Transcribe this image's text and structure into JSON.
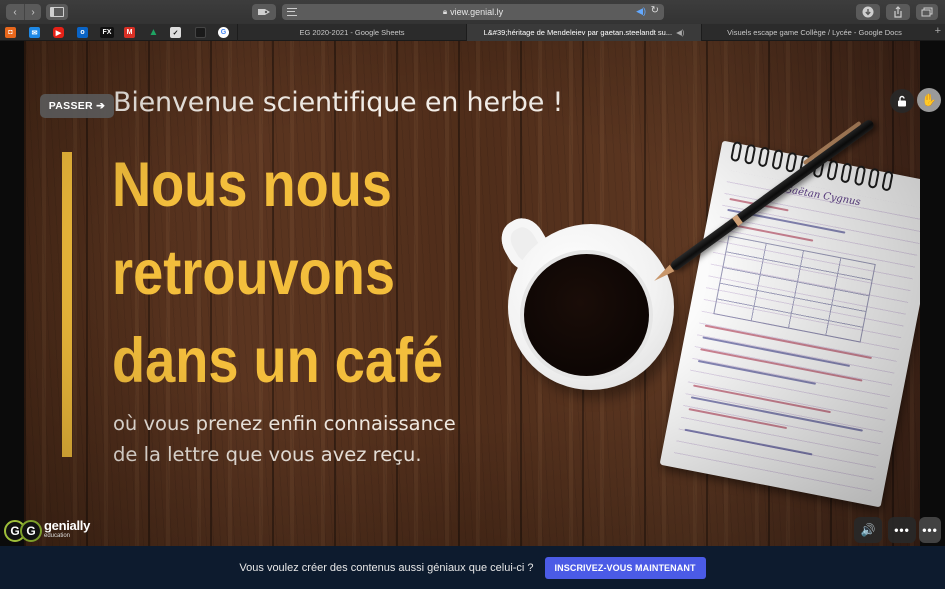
{
  "browser": {
    "url": "view.genial.ly",
    "tabs": [
      {
        "label": "EG 2020-2021 - Google Sheets"
      },
      {
        "label": "L&#39;héritage de Mendeleiev par gaetan.steelandt su..."
      },
      {
        "label": "Visuels escape game Collège / Lycée - Google Docs"
      }
    ],
    "bookmarks": [
      {
        "icon": "bookmark-orange-icon",
        "color": "#e8671c"
      },
      {
        "icon": "bookmark-blue-icon",
        "color": "#1e88e5"
      },
      {
        "icon": "youtube-icon",
        "color": "#e62117"
      },
      {
        "icon": "outlook-icon",
        "color": "#0a64c6"
      },
      {
        "icon": "fx-icon",
        "color": "#111111"
      },
      {
        "icon": "gmail-icon",
        "color": "#d93025"
      },
      {
        "icon": "google-drive-icon",
        "color": "#1fa463"
      },
      {
        "icon": "nike-icon",
        "color": "#dddddd"
      },
      {
        "icon": "dark-square-icon",
        "color": "#1a1a1a"
      },
      {
        "icon": "google-icon",
        "color": "#ffffff"
      }
    ]
  },
  "slide": {
    "skip_label": "PASSER ➔",
    "greeting": "Bienvenue scientifique en herbe !",
    "headline": [
      "Nous nous",
      "retrouvons",
      "dans un café"
    ],
    "subtitle": [
      "où vous prenez enfin connaissance",
      "de la lettre que vous avez reçu."
    ],
    "notebook_title": "Gaëtan Cygnus",
    "accent_color": "#f3be3c"
  },
  "brand": {
    "name": "genially",
    "sub": "education"
  },
  "controls": {
    "volume": "🔊",
    "more": "•••"
  },
  "footer": {
    "message": "Vous voulez créer des contenus aussi géniaux que celui-ci ?",
    "cta": "INSCRIVEZ-VOUS MAINTENANT"
  }
}
